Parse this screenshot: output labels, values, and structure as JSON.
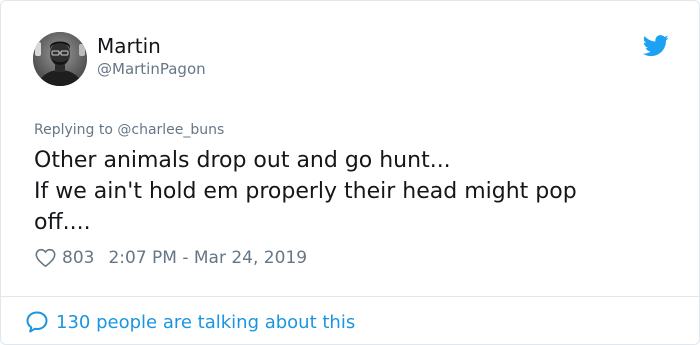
{
  "author": {
    "display_name": "Martin",
    "handle": "@MartinPagon"
  },
  "reply": {
    "prefix": "Replying to ",
    "mention": "@charlee_buns"
  },
  "tweet": {
    "lines": [
      "Other animals drop out and go hunt...",
      "If we ain't hold em properly their head might pop",
      "off...."
    ]
  },
  "meta": {
    "likes": "803",
    "timestamp": "2:07 PM - Mar 24, 2019"
  },
  "footer": {
    "talking_text": "130 people are talking about this"
  },
  "icons": {
    "brand": "twitter-bird-icon",
    "like": "heart-icon",
    "reply": "speech-bubble-icon"
  },
  "colors": {
    "accent": "#1da1f2",
    "link": "#1b95e0",
    "secondary_text": "#657786",
    "border": "#e1e8ed"
  }
}
